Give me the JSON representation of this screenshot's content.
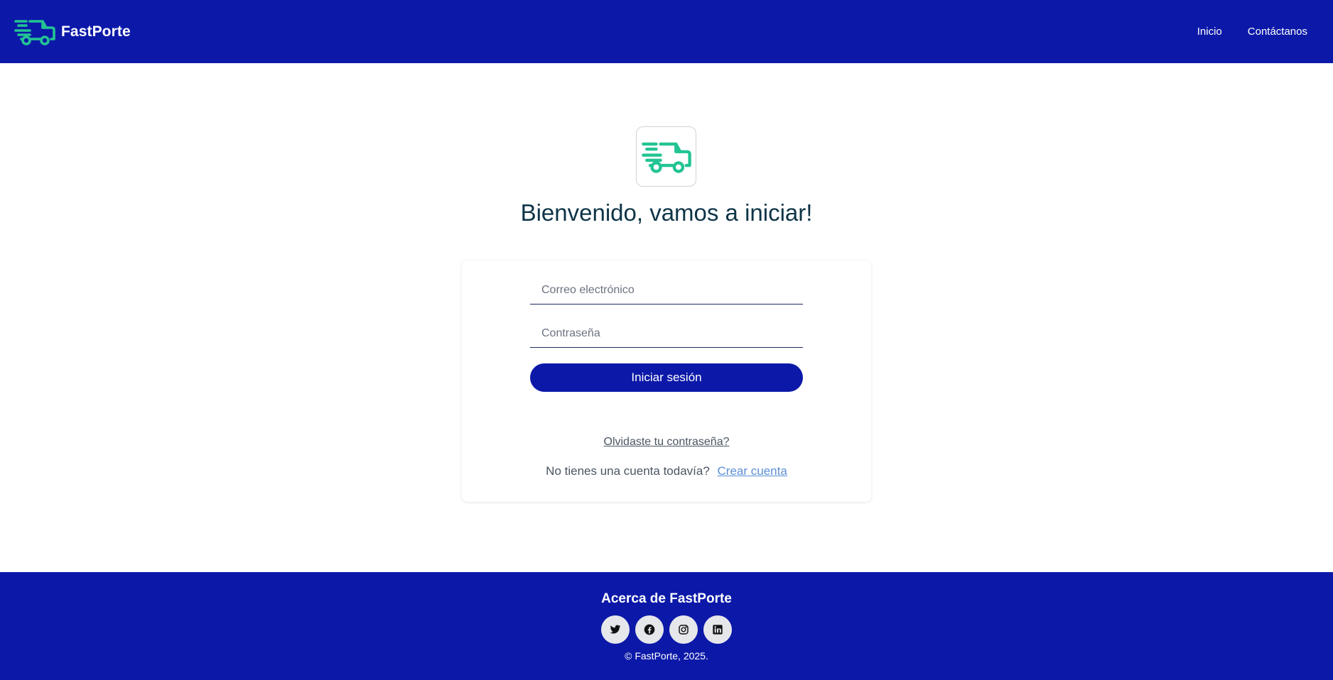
{
  "navbar": {
    "brand_name": "FastPorte",
    "brand_icon": "delivery-truck-icon",
    "links": [
      {
        "label": "Inicio"
      },
      {
        "label": "Contáctanos"
      }
    ]
  },
  "hero": {
    "icon": "delivery-truck-icon",
    "welcome": "Bienvenido, vamos a iniciar!"
  },
  "login_form": {
    "email_placeholder": "Correo electrónico",
    "password_placeholder": "Contraseña",
    "submit_label": "Iniciar sesión",
    "forgot_label": "Olvidaste tu contraseña?",
    "no_account_text": "No tienes una cuenta todavía?",
    "create_account_label": "Crear cuenta"
  },
  "footer": {
    "title": "Acerca de FastPorte",
    "social": [
      {
        "icon": "twitter-icon"
      },
      {
        "icon": "facebook-icon"
      },
      {
        "icon": "instagram-icon"
      },
      {
        "icon": "linkedin-icon"
      }
    ],
    "copyright": "© FastPorte, 2025."
  },
  "colors": {
    "primary": "#0c19a8",
    "accent": "#22c493",
    "heading": "#0e3447",
    "link": "#5b8fd6"
  }
}
